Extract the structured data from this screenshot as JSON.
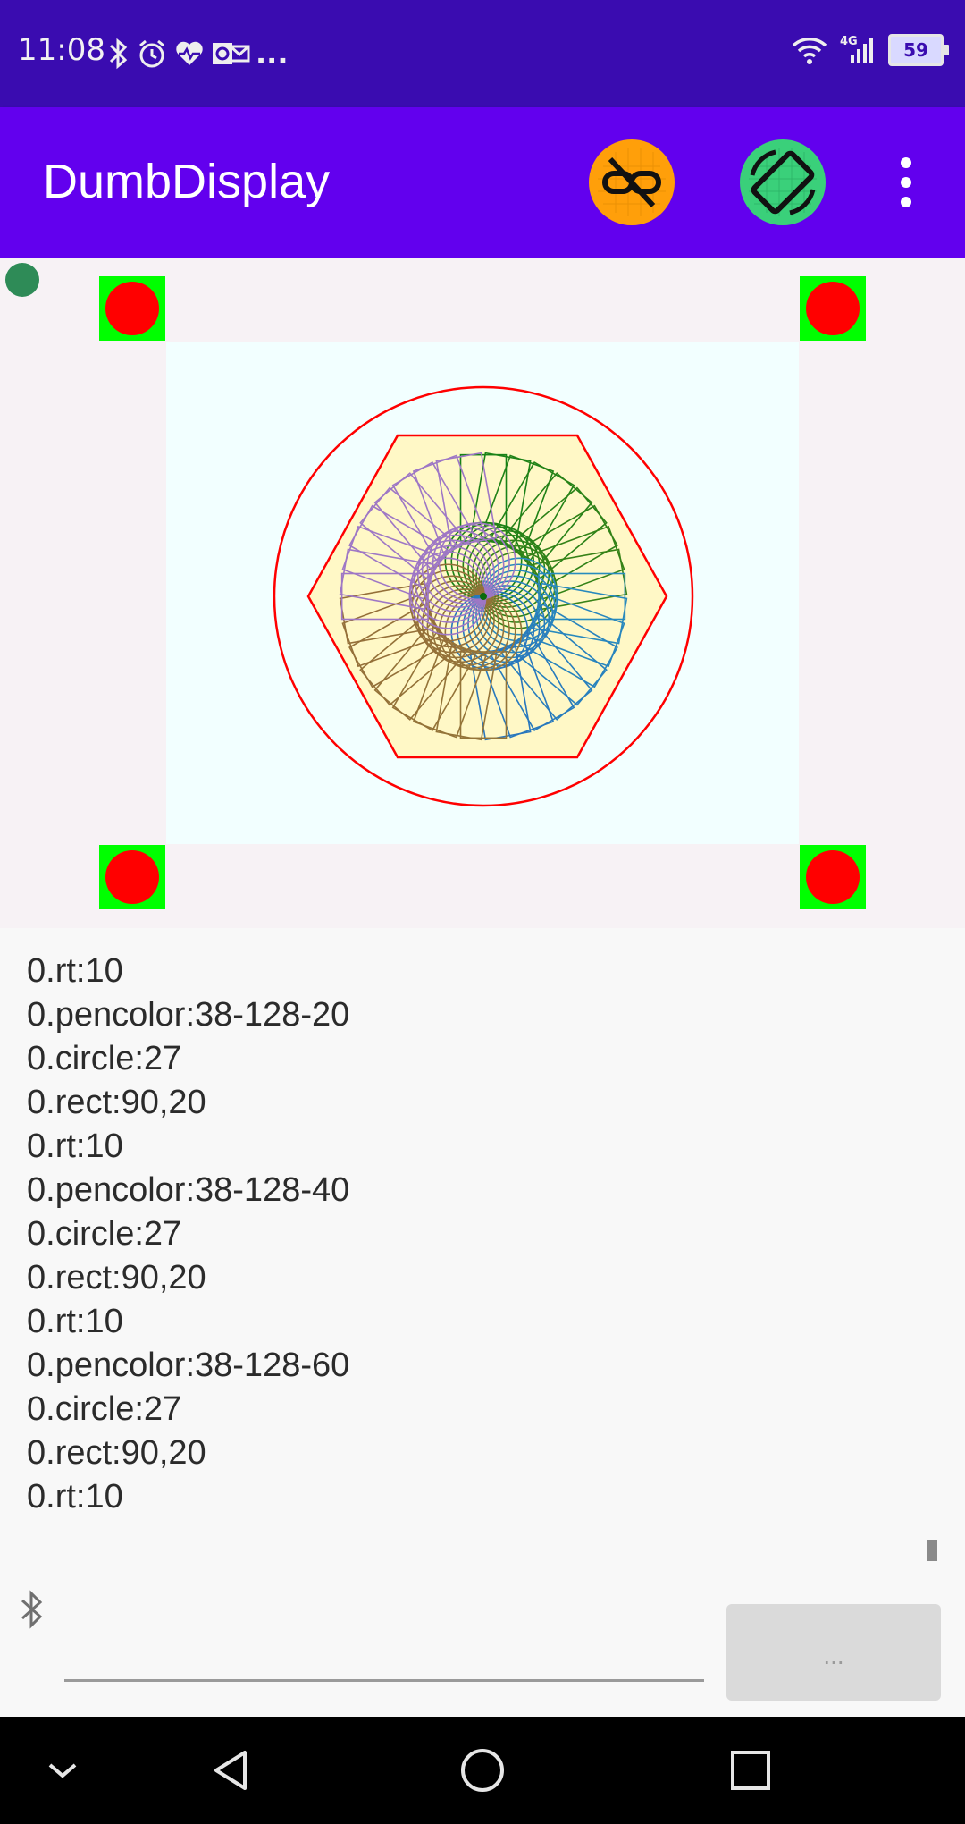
{
  "status_bar": {
    "time": "11:08",
    "overflow_text": "...",
    "battery": "59",
    "network": "4G"
  },
  "app_bar": {
    "title": "DumbDisplay",
    "link_button_icon": "link-off-icon",
    "rotate_button_icon": "screen-rotation-icon",
    "menu_icon": "more-vert-icon"
  },
  "colors": {
    "status_bar": "#3a0cb0",
    "app_bar": "#6200ee",
    "connection_dot": "#2e8b57",
    "corner_square": "#00ff00",
    "corner_circle": "#ff0000",
    "drawing_background": "#f2ffff"
  },
  "log": {
    "lines": [
      "0.rt:10",
      "0.pencolor:38-128-20",
      "0.circle:27",
      "0.rect:90,20",
      "0.rt:10",
      "0.pencolor:38-128-40",
      "0.circle:27",
      "0.rect:90,20",
      "0.rt:10",
      "0.pencolor:38-128-60",
      "0.circle:27",
      "0.rect:90,20",
      "0.rt:10"
    ]
  },
  "input": {
    "send_label": "...",
    "bluetooth_icon": "bluetooth-icon"
  },
  "nav_bar": {
    "icons": [
      "chevron-down-icon",
      "back-icon",
      "home-icon",
      "recents-icon"
    ]
  }
}
